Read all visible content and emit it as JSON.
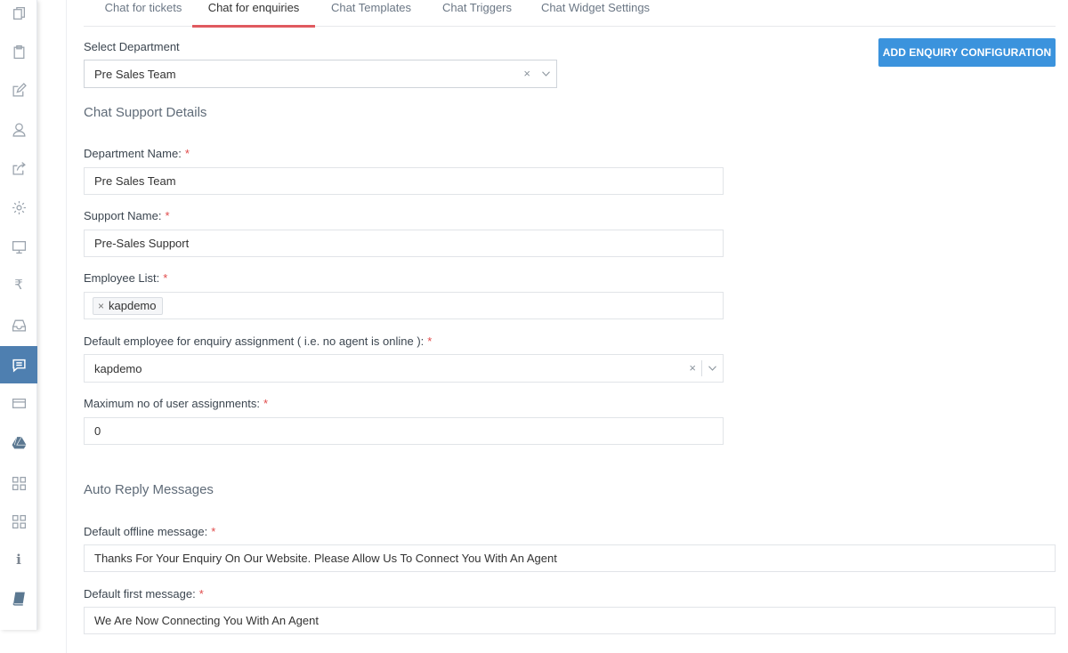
{
  "tabs": [
    {
      "label": "Chat for tickets"
    },
    {
      "label": "Chat for enquiries"
    },
    {
      "label": "Chat Templates"
    },
    {
      "label": "Chat Triggers"
    },
    {
      "label": "Chat Widget Settings"
    }
  ],
  "active_tab": "Chat for enquiries",
  "sidebar": {
    "items": [
      {
        "icon": "copy-icon"
      },
      {
        "icon": "clipboard-icon"
      },
      {
        "icon": "edit-icon"
      },
      {
        "icon": "user-icon"
      },
      {
        "icon": "share-icon"
      },
      {
        "icon": "gear-icon"
      },
      {
        "icon": "monitor-icon"
      },
      {
        "icon": "rupee-icon",
        "glyph": "₹"
      },
      {
        "icon": "inbox-icon"
      },
      {
        "icon": "chat-icon",
        "active": true
      },
      {
        "icon": "card-icon"
      },
      {
        "icon": "drive-icon"
      },
      {
        "icon": "grid-icon"
      },
      {
        "icon": "grid-icon"
      },
      {
        "icon": "info-icon",
        "glyph": "i"
      },
      {
        "icon": "book-icon"
      }
    ]
  },
  "department": {
    "label": "Select Department",
    "value": "Pre Sales Team",
    "clear": "×"
  },
  "add_button": "ADD ENQUIRY CONFIGURATION",
  "chat_support": {
    "title": "Chat Support Details",
    "department_name": {
      "label": "Department Name:",
      "value": "Pre Sales Team"
    },
    "support_name": {
      "label": "Support Name:",
      "value": "Pre-Sales Support"
    },
    "employee_list": {
      "label": "Employee List:",
      "chips": [
        "kapdemo"
      ]
    },
    "default_employee": {
      "label": "Default employee for enquiry assignment ( i.e. no agent is online ):",
      "value": "kapdemo",
      "clear": "×"
    },
    "max_assignments": {
      "label": "Maximum no of user assignments:",
      "value": "0"
    }
  },
  "auto_reply": {
    "title": "Auto Reply Messages",
    "offline": {
      "label": "Default offline message:",
      "value": "Thanks For Your Enquiry On Our Website. Please Allow Us To Connect You With An Agent"
    },
    "first": {
      "label": "Default first message:",
      "value": "We Are Now Connecting You With An Agent"
    }
  },
  "required_mark": "*",
  "colors": {
    "accent": "#3b93dd",
    "active_tab_underline": "#e05a5f",
    "sidebar_active": "#4e7fb0"
  }
}
